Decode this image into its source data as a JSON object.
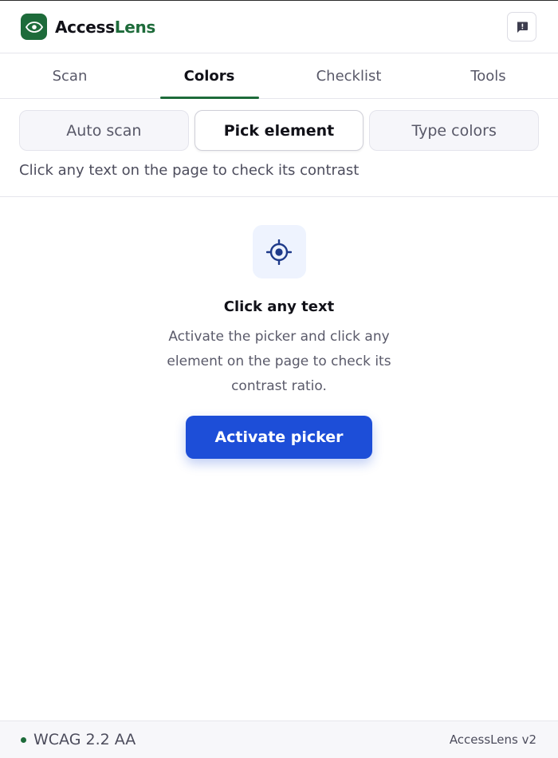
{
  "app": {
    "brand_part1": "Access",
    "brand_part2": "Lens",
    "logo_icon": "eye-icon",
    "feedback_icon": "feedback-icon",
    "brand_color": "#1d6b3a"
  },
  "tabs": [
    {
      "label": "Scan",
      "active": false
    },
    {
      "label": "Colors",
      "active": true
    },
    {
      "label": "Checklist",
      "active": false
    },
    {
      "label": "Tools",
      "active": false
    }
  ],
  "modes": [
    {
      "label": "Auto scan",
      "active": false
    },
    {
      "label": "Pick element",
      "active": true
    },
    {
      "label": "Type colors",
      "active": false
    }
  ],
  "mode_hint": "Click any text on the page to check its contrast",
  "empty_state": {
    "icon": "crosshair-icon",
    "title": "Click any text",
    "description": "Activate the picker and click any element on the page to check its contrast ratio.",
    "button_label": "Activate picker",
    "button_color": "#1d4ed8"
  },
  "footer": {
    "standard": "WCAG 2.2 AA",
    "version": "AccessLens v2"
  }
}
